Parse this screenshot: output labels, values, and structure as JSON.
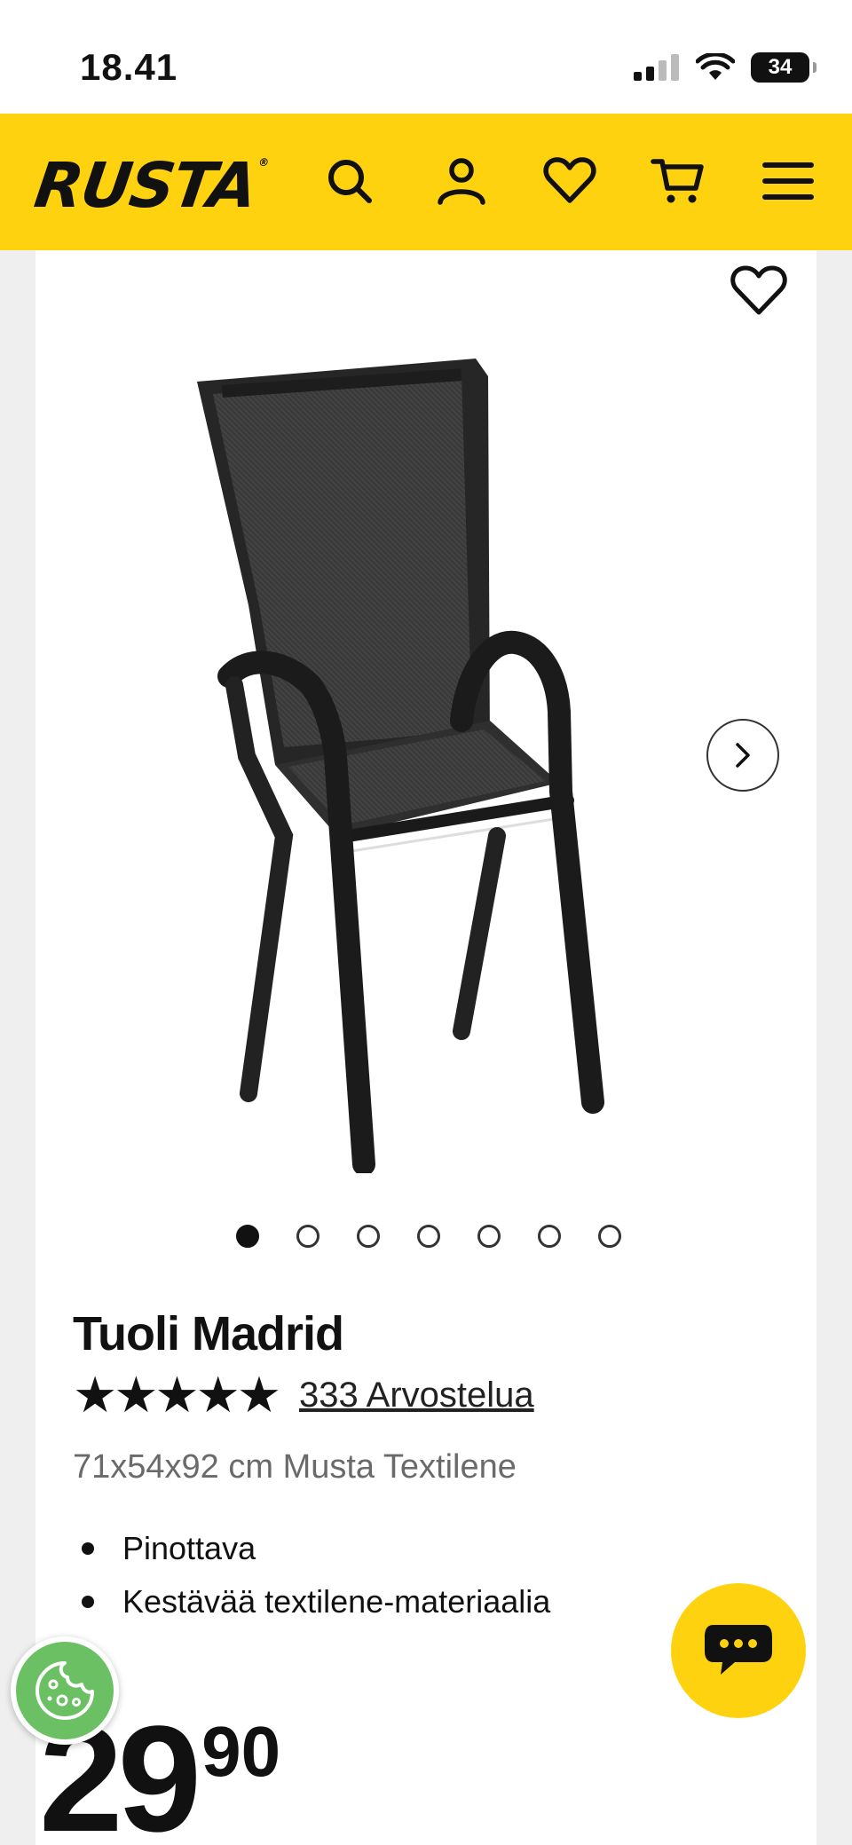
{
  "status_bar": {
    "time": "18.41",
    "battery": "34"
  },
  "header": {
    "logo": "RUSTA",
    "icons": [
      "search-icon",
      "user-icon",
      "heart-icon",
      "cart-icon",
      "menu-icon"
    ],
    "accent_color": "#ffd20f"
  },
  "gallery": {
    "dots_count": 7,
    "active_index": 0
  },
  "product": {
    "title": "Tuoli Madrid",
    "stars": "★★★★★",
    "rating": 5,
    "reviews_link": "333 Arvostelua",
    "subtitle": "71x54x92 cm Musta Textilene",
    "features": [
      "Pinottava",
      "Kestävää textilene-materiaalia"
    ],
    "price_integer": "29",
    "price_decimals": "90"
  },
  "colors": {
    "chat_button": "#ffd20f",
    "cookie_button": "#6cc064"
  }
}
